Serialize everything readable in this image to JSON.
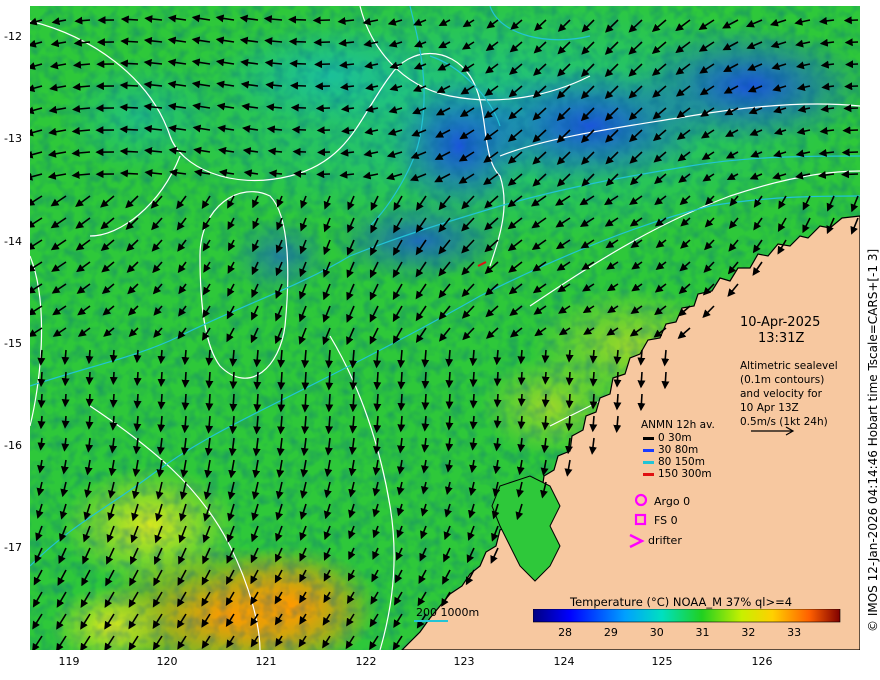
{
  "map": {
    "lon_ticks": [
      "119",
      "120",
      "121",
      "122",
      "123",
      "124",
      "125",
      "126"
    ],
    "lat_ticks": [
      "-12",
      "-13",
      "-14",
      "-15",
      "-16",
      "-17"
    ],
    "lon_range": [
      118.6,
      126.9
    ],
    "lat_range": [
      -17.9,
      -11.7
    ],
    "colors": {
      "land": "#f7c8a0",
      "coast": "#000000",
      "sea_contour": "#ffffff",
      "bathy": "#22c4d6"
    }
  },
  "overlay": {
    "date": "10-Apr-2025",
    "time": "13:31Z",
    "altimetry_lines": [
      "Altimetric sealevel",
      "(0.1m contours)",
      "and velocity for",
      "10 Apr 13Z",
      "0.5m/s (1kt 24h)"
    ]
  },
  "legend": {
    "title": "ANMN 12h av.",
    "depths": [
      {
        "label": "0 30m",
        "color": "#000000"
      },
      {
        "label": "30 80m",
        "color": "#1a3cff"
      },
      {
        "label": "80 150m",
        "color": "#22c4d6"
      },
      {
        "label": "150 300m",
        "color": "#e01010"
      }
    ],
    "argo": "Argo 0",
    "fs": "FS 0",
    "drifter": "drifter",
    "marker_color": "#ff00ff"
  },
  "bathy_legend": "200  1000m",
  "colorbar": {
    "title": "Temperature (°C) NOAA_M 37% ql>=4",
    "labels": [
      "28",
      "29",
      "30",
      "31",
      "32",
      "33"
    ],
    "range": [
      27.3,
      34.0
    ]
  },
  "credit": "© IMOS 12-Jan-2026 04:14:46 Hobart time Tscale=CARS+[-1 3]"
}
